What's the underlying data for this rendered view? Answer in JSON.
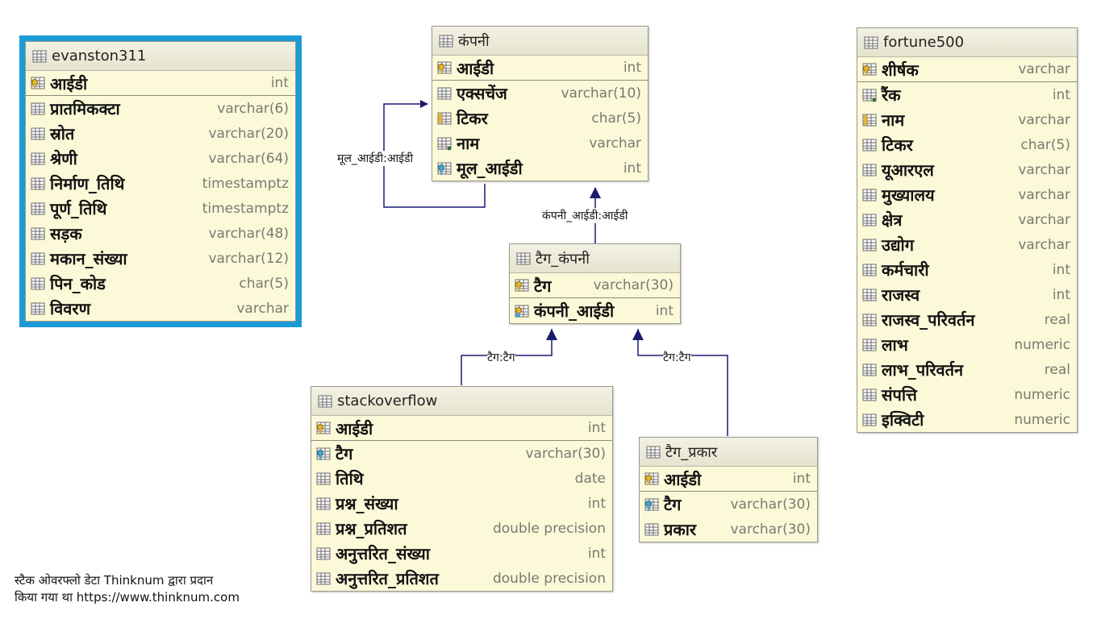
{
  "entities": {
    "evanston311": {
      "title": "evanston311",
      "columns": [
        {
          "name": "आईडी",
          "type": "int",
          "icon": "primary-key-icon"
        },
        {
          "name": "प्रातमिकक्टा",
          "type": "varchar(6)",
          "icon": "column-icon"
        },
        {
          "name": "स्रोत",
          "type": "varchar(20)",
          "icon": "column-icon"
        },
        {
          "name": "श्रेणी",
          "type": "varchar(64)",
          "icon": "column-icon"
        },
        {
          "name": "निर्माण_तिथि",
          "type": "timestamptz",
          "icon": "column-icon"
        },
        {
          "name": "पूर्ण_तिथि",
          "type": "timestamptz",
          "icon": "column-icon"
        },
        {
          "name": "सड़क",
          "type": "varchar(48)",
          "icon": "column-icon"
        },
        {
          "name": "मकान_संख्या",
          "type": "varchar(12)",
          "icon": "column-icon"
        },
        {
          "name": "पिन_कोड",
          "type": "char(5)",
          "icon": "column-icon"
        },
        {
          "name": "विवरण",
          "type": "varchar",
          "icon": "column-icon"
        }
      ]
    },
    "company": {
      "title": "कंपनी",
      "columns": [
        {
          "name": "आईडी",
          "type": "int",
          "icon": "primary-key-icon"
        },
        {
          "name": "एक्सचेंज",
          "type": "varchar(10)",
          "icon": "column-icon"
        },
        {
          "name": "टिकर",
          "type": "char(5)",
          "icon": "unique-column-icon"
        },
        {
          "name": "नाम",
          "type": "varchar",
          "icon": "nullable-column-icon"
        },
        {
          "name": "मूल_आईडी",
          "type": "int",
          "icon": "foreign-key-icon"
        }
      ]
    },
    "fortune500": {
      "title": "fortune500",
      "columns": [
        {
          "name": "शीर्षक",
          "type": "varchar",
          "icon": "primary-key-icon"
        },
        {
          "name": "रैंक",
          "type": "int",
          "icon": "nullable-column-icon"
        },
        {
          "name": "नाम",
          "type": "varchar",
          "icon": "unique-column-icon"
        },
        {
          "name": "टिकर",
          "type": "char(5)",
          "icon": "column-icon"
        },
        {
          "name": "यूआरएल",
          "type": "varchar",
          "icon": "column-icon"
        },
        {
          "name": "मुख्यालय",
          "type": "varchar",
          "icon": "column-icon"
        },
        {
          "name": "क्षेत्र",
          "type": "varchar",
          "icon": "column-icon"
        },
        {
          "name": "उद्योग",
          "type": "varchar",
          "icon": "column-icon"
        },
        {
          "name": "कर्मचारी",
          "type": "int",
          "icon": "column-icon"
        },
        {
          "name": "राजस्व",
          "type": "int",
          "icon": "column-icon"
        },
        {
          "name": "राजस्व_परिवर्तन",
          "type": "real",
          "icon": "column-icon"
        },
        {
          "name": "लाभ",
          "type": "numeric",
          "icon": "column-icon"
        },
        {
          "name": "लाभ_परिवर्तन",
          "type": "real",
          "icon": "column-icon"
        },
        {
          "name": "संपत्ति",
          "type": "numeric",
          "icon": "column-icon"
        },
        {
          "name": "इक्विटी",
          "type": "numeric",
          "icon": "column-icon"
        }
      ]
    },
    "tag_company": {
      "title": "टैग_कंपनी",
      "columns": [
        {
          "name": "टैग",
          "type": "varchar(30)",
          "icon": "primary-key-icon"
        },
        {
          "name": "कंपनी_आईडी",
          "type": "int",
          "icon": "primary-foreign-key-icon"
        }
      ]
    },
    "stackoverflow": {
      "title": "stackoverflow",
      "columns": [
        {
          "name": "आईडी",
          "type": "int",
          "icon": "primary-key-icon"
        },
        {
          "name": "टैग",
          "type": "varchar(30)",
          "icon": "foreign-key-icon"
        },
        {
          "name": "तिथि",
          "type": "date",
          "icon": "column-icon"
        },
        {
          "name": "प्रश्न_संख्या",
          "type": "int",
          "icon": "column-icon"
        },
        {
          "name": "प्रश्न_प्रतिशत",
          "type": "double precision",
          "icon": "column-icon"
        },
        {
          "name": "अनुत्तरित_संख्या",
          "type": "int",
          "icon": "column-icon"
        },
        {
          "name": "अनुत्तरित_प्रतिशत",
          "type": "double precision",
          "icon": "column-icon"
        }
      ]
    },
    "tag_type": {
      "title": "टैग_प्रकार",
      "columns": [
        {
          "name": "आईडी",
          "type": "int",
          "icon": "primary-key-icon"
        },
        {
          "name": "टैग",
          "type": "varchar(30)",
          "icon": "foreign-key-icon"
        },
        {
          "name": "प्रकार",
          "type": "varchar(30)",
          "icon": "column-icon"
        }
      ]
    }
  },
  "relationships": [
    {
      "label": "मूल_आईडी:आईडी",
      "from": "company",
      "to": "company"
    },
    {
      "label": "कंपनी_आईडी:आईडी",
      "from": "tag_company",
      "to": "company"
    },
    {
      "label": "टैग:टैग",
      "from": "stackoverflow",
      "to": "tag_company"
    },
    {
      "label": "टैग:टैग",
      "from": "tag_type",
      "to": "tag_company"
    }
  ],
  "caption": {
    "line1": "स्टैक ओवरफ्लो डेटा Thinknum द्वारा प्रदान",
    "line2": "किया गया था https://www.thinknum.com"
  },
  "colors": {
    "entity_fill": "#fbf9d8",
    "selection_border": "#1b9ad6",
    "connector": "#1a1a6e"
  }
}
